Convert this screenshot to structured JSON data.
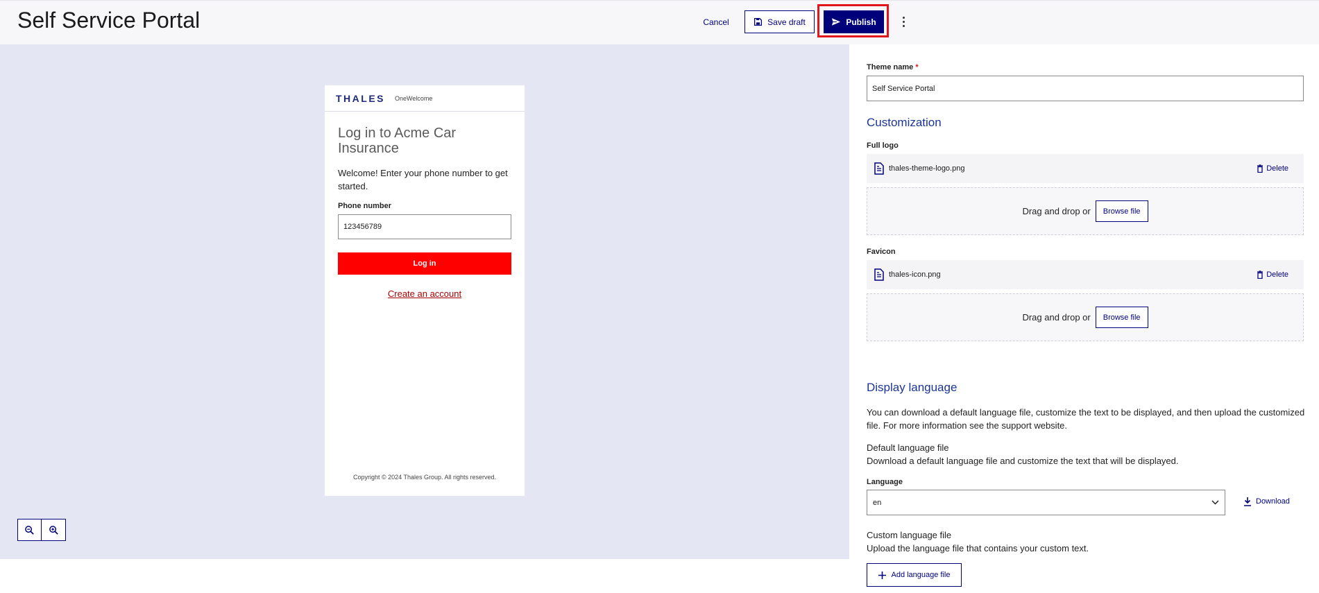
{
  "header": {
    "title": "Self Service Portal",
    "cancel_label": "Cancel",
    "save_draft_label": "Save draft",
    "publish_label": "Publish"
  },
  "preview": {
    "logo_text": "THALES",
    "product_text": "OneWelcome",
    "title": "Log in to Acme Car Insurance",
    "welcome": "Welcome! Enter your phone number to get started.",
    "phone_label": "Phone number",
    "phone_value": "123456789",
    "login_label": "Log in",
    "create_account_label": "Create an account",
    "copyright": "Copyright © 2024 Thales Group. All rights reserved.",
    "brand_color": "#ff0000"
  },
  "panel": {
    "theme_name_label": "Theme name",
    "theme_name_required": "*",
    "theme_name_value": "Self Service Portal",
    "customization_heading": "Customization",
    "full_logo_label": "Full logo",
    "full_logo_file": "thales-theme-logo.png",
    "favicon_label": "Favicon",
    "favicon_file": "thales-icon.png",
    "delete_label": "Delete",
    "drag_drop_text": "Drag and drop or",
    "browse_label": "Browse file",
    "display_language_heading": "Display language",
    "display_language_text": "You can download a default language file, customize the text to be displayed, and then upload the customized file. For more information see the support website.",
    "default_file_title": "Default language file",
    "default_file_text": "Download a default language file and customize the text that will be displayed.",
    "language_label": "Language",
    "language_value": "en",
    "download_label": "Download",
    "custom_file_title": "Custom language file",
    "custom_file_text": "Upload the language file that contains your custom text.",
    "add_file_label": "Add language file"
  },
  "colors": {
    "accent": "#00007a",
    "highlight": "#e2141c",
    "preview_bg": "#e4e6f4"
  },
  "icons": [
    "save-icon",
    "send-icon",
    "more-vertical-icon",
    "zoom-in-icon",
    "zoom-out-icon",
    "file-icon",
    "trash-icon",
    "chevron-down-icon",
    "download-icon",
    "plus-icon"
  ]
}
